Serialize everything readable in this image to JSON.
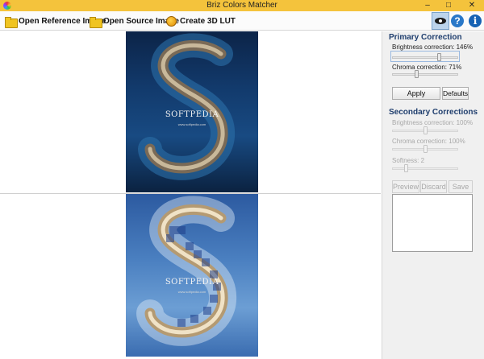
{
  "window": {
    "title": "Briz Colors Matcher",
    "minimize": "–",
    "maximize": "□",
    "close": "✕"
  },
  "toolbar": {
    "open_reference": "Open Reference Image",
    "open_source": "Open Source Image",
    "create_lut": "Create 3D LUT",
    "icons": {
      "open_reference": "folder-icon",
      "open_source": "folder-icon",
      "create_lut": "lut-icon",
      "preview": "eye-icon",
      "help": "help-icon",
      "info": "info-icon"
    },
    "help_glyph": "?",
    "info_glyph": "i"
  },
  "images": {
    "reference": {
      "watermark": "SOFTPEDIA",
      "sub": "www.softpedia.com"
    },
    "source": {
      "watermark": "SOFTPEDIA",
      "sub": "www.softpedia.com"
    }
  },
  "primary": {
    "title": "Primary Correction",
    "brightness_label": "Brightness correction: 146%",
    "brightness_value": 0.73,
    "chroma_label": "Chroma correction: 71%",
    "chroma_value": 0.36,
    "apply": "Apply",
    "defaults": "Defaults"
  },
  "secondary": {
    "title": "Secondary Corrections",
    "brightness_label": "Brightness correction: 100%",
    "brightness_value": 0.5,
    "chroma_label": "Chroma correction: 100%",
    "chroma_value": 0.5,
    "softness_label": "Softness: 2",
    "softness_value": 0.2,
    "preview": "Preview",
    "discard": "Discard",
    "save": "Save"
  },
  "colors": {
    "titlebar": "#f4c33c",
    "accent": "#1f3e6e",
    "eye_active": "#bcd4ec"
  }
}
